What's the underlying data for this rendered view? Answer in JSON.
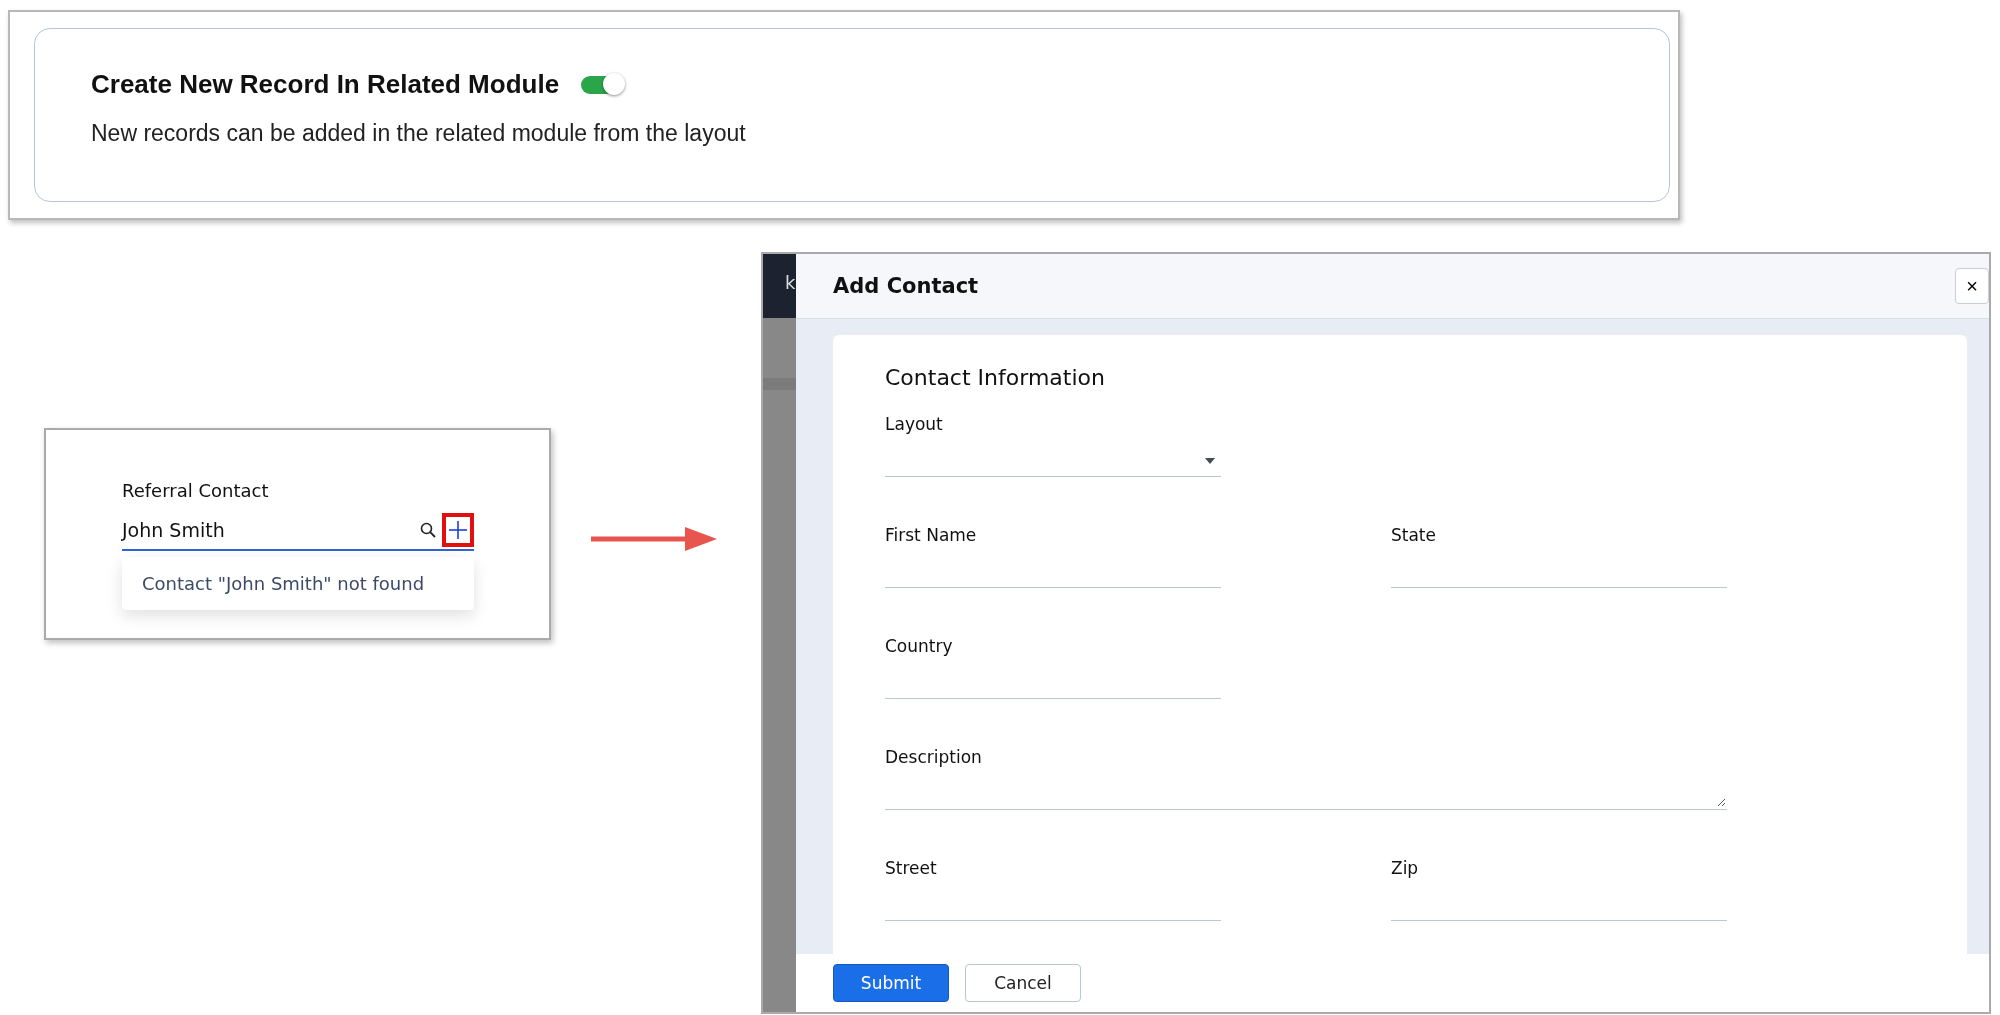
{
  "setting": {
    "title": "Create New Record In Related Module",
    "enabled": true,
    "description": "New records can be added in the related module from the layout"
  },
  "lookup": {
    "label": "Referral Contact",
    "value": "John Smith",
    "suggestion": "Contact \"John Smith\" not found"
  },
  "backdrop": {
    "nav_text": "k"
  },
  "dialog": {
    "title": "Add Contact",
    "close": "×",
    "section": "Contact Information",
    "rows": [
      [
        {
          "label": "Layout",
          "kind": "dropdown"
        }
      ],
      [
        {
          "label": "First Name",
          "kind": "text"
        },
        {
          "label": "State",
          "kind": "text"
        }
      ],
      [
        {
          "label": "Country",
          "kind": "text"
        }
      ],
      [
        {
          "label": "Description",
          "kind": "textarea"
        }
      ],
      [
        {
          "label": "Street",
          "kind": "text"
        },
        {
          "label": "Zip",
          "kind": "text"
        }
      ]
    ],
    "buttons": [
      {
        "label": "Submit",
        "kind": "primary"
      },
      {
        "label": "Cancel",
        "kind": "secondary"
      }
    ]
  }
}
